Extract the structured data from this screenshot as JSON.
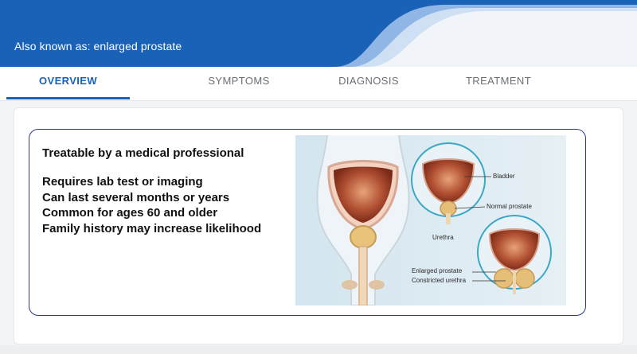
{
  "header": {
    "subtitle": "Also known as: enlarged prostate",
    "brand_color": "#1a62b8"
  },
  "tabs": [
    {
      "label": "OVERVIEW",
      "active": true
    },
    {
      "label": "SYMPTOMS",
      "active": false
    },
    {
      "label": "DIAGNOSIS",
      "active": false
    },
    {
      "label": "TREATMENT",
      "active": false
    }
  ],
  "overview": {
    "headline": "Treatable by a medical professional",
    "facts": [
      "Requires lab test or imaging",
      "Can last several months or years",
      "Common for ages 60 and older",
      "Family history may increase likelihood"
    ],
    "diagram_labels": {
      "bladder": "Bladder",
      "normal_prostate": "Normal prostate",
      "urethra": "Urethra",
      "enlarged_prostate": "Enlarged prostate",
      "constricted_urethra": "Constricted urethra"
    }
  }
}
